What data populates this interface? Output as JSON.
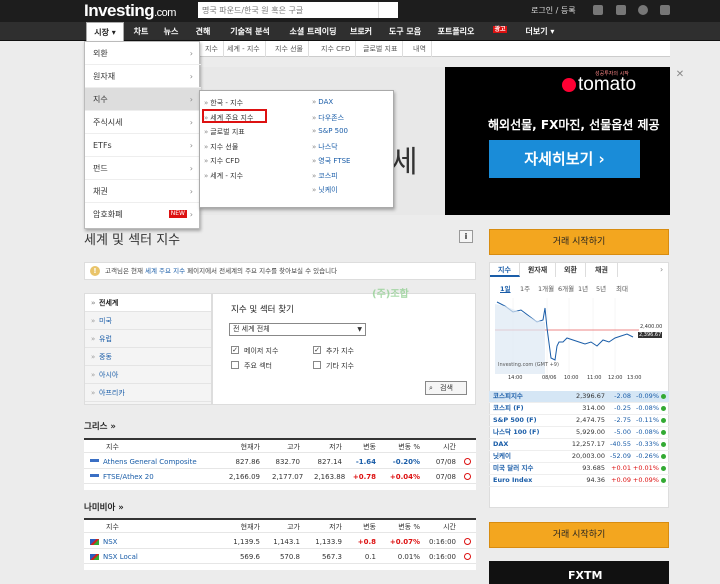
{
  "header": {
    "logo": "Investing",
    "logo_domain": ".com",
    "search_placeholder": "명국 파운드/한국 원 혹은 구글",
    "login": "로그인 / 등록"
  },
  "nav": {
    "items": [
      "시장",
      "차트",
      "뉴스",
      "견해",
      "기술적 분석",
      "소셜 트레이딩",
      "브로커",
      "도구 모음",
      "포트폴리오",
      "광고",
      "더보기"
    ]
  },
  "subnav": {
    "items": [
      "지수",
      "세계 - 지수",
      "지수 선물",
      "지수 CFD",
      "글로벌 지표",
      "내역"
    ]
  },
  "dropdown": {
    "items": [
      "외환",
      "원자재",
      "지수",
      "주식시세",
      "ETFs",
      "펀드",
      "채권",
      "암호화폐"
    ],
    "crypto_badge": "NEW"
  },
  "flyout": {
    "left": [
      "한국 - 지수",
      "세계 주요 지수",
      "글로벌 지표",
      "지수 선물",
      "지수 CFD",
      "세계 - 지수"
    ],
    "right": [
      "DAX",
      "다우존스",
      "S&P 500",
      "나스닥",
      "영국 FTSE",
      "코스피",
      "닛케이"
    ]
  },
  "ad": {
    "tomato_small": "성공투자의 시작",
    "brand": "tomato",
    "tagline": "해외선물, FX마진, 선물옵션 제공",
    "button": "자세히보기 ›",
    "big_char": "세"
  },
  "page": {
    "title": "세계 및 섹터 지수",
    "info": "i"
  },
  "notice": {
    "p1": "고객님은 현재",
    "link": "세계 주요 지수",
    "p2": "페이지에서 전세계의 주요 지수를 찾아보실 수 있습니다"
  },
  "regions": [
    "전세계",
    "미국",
    "유럽",
    "중동",
    "아시아",
    "아프리카"
  ],
  "finder": {
    "title": "지수 및 섹터 찾기",
    "select": "전 세계 전체",
    "checks": [
      {
        "label": "메이저 지수",
        "checked": true
      },
      {
        "label": "추가 지수",
        "checked": true
      },
      {
        "label": "주요 섹터",
        "checked": false
      },
      {
        "label": "기타 지수",
        "checked": false
      }
    ],
    "search": "검색"
  },
  "watermark": "(주)조합",
  "greece": {
    "title": "그리스 »",
    "headers": [
      "지수",
      "현재가",
      "고가",
      "저가",
      "변동",
      "변동 %",
      "시간"
    ],
    "rows": [
      {
        "name": "Athens General Composite",
        "last": "827.86",
        "high": "832.70",
        "low": "827.14",
        "chg": "-1.64",
        "pct": "-0.20%",
        "time": "07/08"
      },
      {
        "name": "FTSE/Athex 20",
        "last": "2,166.09",
        "high": "2,177.07",
        "low": "2,163.88",
        "chg": "+0.78",
        "pct": "+0.04%",
        "time": "07/08"
      }
    ]
  },
  "namibia": {
    "title": "나미비아 »",
    "headers": [
      "지수",
      "현재가",
      "고가",
      "저가",
      "변동",
      "변동 %",
      "시간"
    ],
    "rows": [
      {
        "name": "NSX",
        "last": "1,139.5",
        "high": "1,143.1",
        "low": "1,133.9",
        "chg": "+0.8",
        "pct": "+0.07%",
        "time": "0:16:00"
      },
      {
        "name": "NSX Local",
        "last": "569.6",
        "high": "570.8",
        "low": "567.3",
        "chg": "0.1",
        "pct": "0.01%",
        "time": "0:16:00"
      }
    ]
  },
  "sidebar": {
    "trade_btn": "거래 시작하기",
    "tabs": [
      "지수",
      "원자재",
      "외환",
      "채권"
    ],
    "periods": [
      "1일",
      "1주",
      "1개월",
      "6개월",
      "1년",
      "5년",
      "최대"
    ],
    "chart_labels": {
      "p1": "2,400.00",
      "p2": "2,396.67",
      "src": "Investing.com (GMT +9)",
      "times": [
        "14:00",
        "08/06",
        "10:00",
        "11:00",
        "12:00",
        "13:00"
      ]
    },
    "rows": [
      {
        "name": "코스피지수",
        "last": "2,396.67",
        "chg": "-2.08",
        "pct": "-0.09%"
      },
      {
        "name": "코스피 (F)",
        "last": "314.00",
        "chg": "-0.25",
        "pct": "-0.08%"
      },
      {
        "name": "S&P 500 (F)",
        "last": "2,474.75",
        "chg": "-2.75",
        "pct": "-0.11%"
      },
      {
        "name": "나스닥 100 (F)",
        "last": "5,929.00",
        "chg": "-5.00",
        "pct": "-0.08%"
      },
      {
        "name": "DAX",
        "last": "12,257.17",
        "chg": "-40.55",
        "pct": "-0.33%"
      },
      {
        "name": "닛케이",
        "last": "20,003.00",
        "chg": "-52.09",
        "pct": "-0.26%"
      },
      {
        "name": "미국 달러 지수",
        "last": "93.685",
        "chg": "+0.01",
        "pct": "+0.01%"
      },
      {
        "name": "Euro Index",
        "last": "94.36",
        "chg": "+0.09",
        "pct": "+0.09%"
      }
    ],
    "fxtm": "FXTM"
  },
  "colors": {
    "accent": "#f3a61f",
    "link": "#1a5da8",
    "up": "#d11",
    "down": "#1a5da8"
  }
}
